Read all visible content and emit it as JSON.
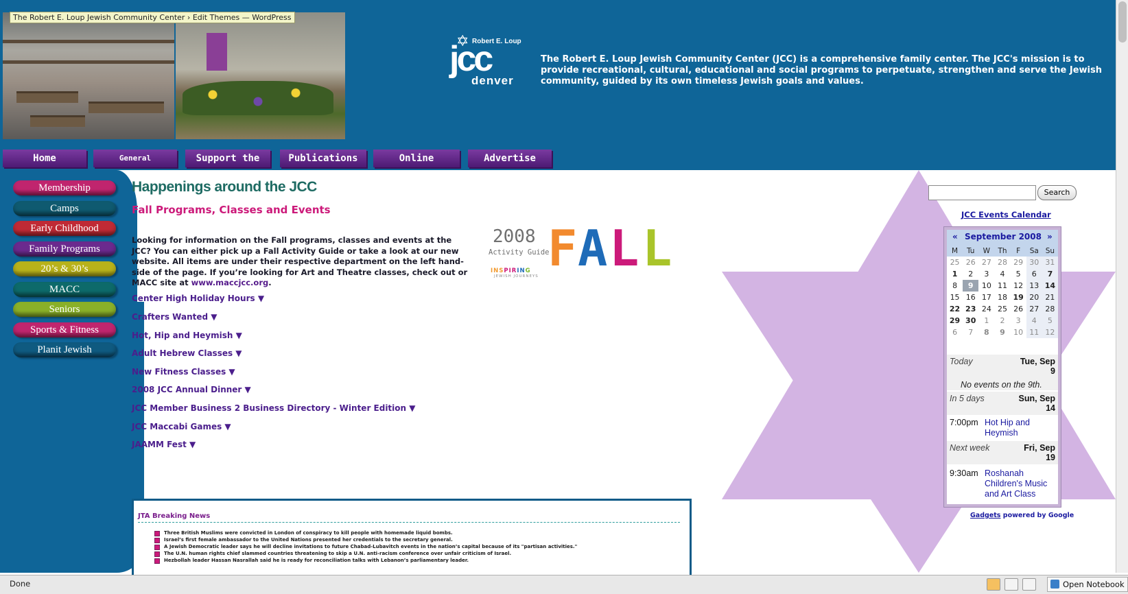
{
  "tooltip": "The Robert E. Loup Jewish Community Center › Edit Themes — WordPress",
  "logo": {
    "top": "Robert E. Loup",
    "mid": "jcc",
    "bottom": "denver"
  },
  "mission": "The Robert E. Loup Jewish Community Center (JCC) is a comprehensive family center. The JCC's mission is to provide recreational, cultural, educational and social programs to perpetuate, strengthen and serve the Jewish community, guided by its own timeless Jewish goals and values.",
  "topnav": [
    "Home",
    "General Information",
    "Support the JCC",
    "Publications",
    "Online Services",
    "Advertise"
  ],
  "sidebar": [
    {
      "label": "Membership",
      "color": "#c0256e"
    },
    {
      "label": "Camps",
      "color": "#0f5a70"
    },
    {
      "label": "Early Childhood",
      "color": "#c02a35"
    },
    {
      "label": "Family Programs",
      "color": "#6b2a8e"
    },
    {
      "label": "20’s & 30’s",
      "color": "#b8b21a"
    },
    {
      "label": "MACC",
      "color": "#0d6a6a"
    },
    {
      "label": "Seniors",
      "color": "#8ab028"
    },
    {
      "label": "Sports & Fitness",
      "color": "#c0256e"
    },
    {
      "label": "Planit Jewish",
      "color": "#0f5a80"
    }
  ],
  "main": {
    "heading": "Happenings around the JCC",
    "subheading": "Fall Programs, Classes and Events",
    "intro": "Looking for information on the Fall programs, classes and events at the JCC? You can either pick up a Fall Activity Guide or take a look at our new website. All items are under their respective department on the left hand-side of the page. If you’re looking for Art and Theatre classes, check out or MACC site at",
    "intro_link": "www.maccjcc.org",
    "intro_end": ".",
    "links": [
      "Center High Holiday Hours ▼",
      "Crafters Wanted ▼",
      "Hot, Hip and Heymish ▼",
      "Adult Hebrew Classes ▼",
      "New Fitness Classes ▼",
      "2008 JCC Annual Dinner ▼",
      "JCC Member Business 2 Business Directory - Winter Edition ▼",
      "JCC Maccabi Games ▼",
      "JAAMM Fest ▼"
    ]
  },
  "fall_graphic": {
    "year": "2008",
    "guide": "Activity Guide",
    "inspiring": [
      "INS",
      "PIR",
      "IN",
      "G"
    ],
    "tagline": "JEWISH JOURNEYS",
    "letters": [
      {
        "ch": "F",
        "color": "#f28a2e"
      },
      {
        "ch": "A",
        "color": "#1e6bb8"
      },
      {
        "ch": "L",
        "color": "#cc1a7a"
      },
      {
        "ch": "L",
        "color": "#a9c42a"
      }
    ]
  },
  "news": {
    "title": "JTA Breaking News",
    "items": [
      "Three British Muslims were convicted in London of conspiracy to kill people with homemade liquid bombs.",
      "Israel’s first female ambassador to the United Nations presented her credentials to the secretary general.",
      "A Jewish Democratic leader says he will decline invitations to future Chabad-Lubavitch events in the nation’s capital because of its \"partisan activities.\"",
      "The U.N. human rights chief slammed countries threatening to skip a U.N. anti-racism conference over unfair criticism of Israel.",
      "Hezbollah leader Hassan Nasrallah said he is ready for reconciliation talks with Lebanon’s parliamentary leader."
    ]
  },
  "search": {
    "button": "Search",
    "value": ""
  },
  "calendar": {
    "link": "JCC Events Calendar",
    "prev": "«",
    "next": "»",
    "month": "September 2008",
    "dow": [
      "M",
      "Tu",
      "W",
      "Th",
      "F",
      "Sa",
      "Su"
    ],
    "weeks": [
      [
        "25",
        "26",
        "27",
        "28",
        "29",
        "30",
        "31"
      ],
      [
        "1",
        "2",
        "3",
        "4",
        "5",
        "6",
        "7"
      ],
      [
        "8",
        "9",
        "10",
        "11",
        "12",
        "13",
        "14"
      ],
      [
        "15",
        "16",
        "17",
        "18",
        "19",
        "20",
        "21"
      ],
      [
        "22",
        "23",
        "24",
        "25",
        "26",
        "27",
        "28"
      ],
      [
        "29",
        "30",
        "1",
        "2",
        "3",
        "4",
        "5"
      ],
      [
        "6",
        "7",
        "8",
        "9",
        "10",
        "11",
        "12"
      ]
    ],
    "agenda": {
      "today_label": "Today",
      "today_date": "Tue, Sep 9",
      "today_msg": "No events on the 9th.",
      "in5_label": "In 5 days",
      "in5_date": "Sun, Sep 14",
      "in5_time": "7:00pm",
      "in5_event": "Hot Hip and Heymish",
      "nextweek_label": "Next week",
      "nextweek_date": "Fri, Sep 19",
      "nextweek_time": "9:30am",
      "nextweek_event": "Roshanah Children's Music and Art Class"
    },
    "gadget_link": "Gadgets",
    "gadget_text": "powered by Google"
  },
  "status": {
    "text": "Done",
    "notebook": "Open Notebook"
  },
  "colors": {
    "header": "#0f6598",
    "star": "#d3b4e3",
    "nav": "#5a2585"
  }
}
